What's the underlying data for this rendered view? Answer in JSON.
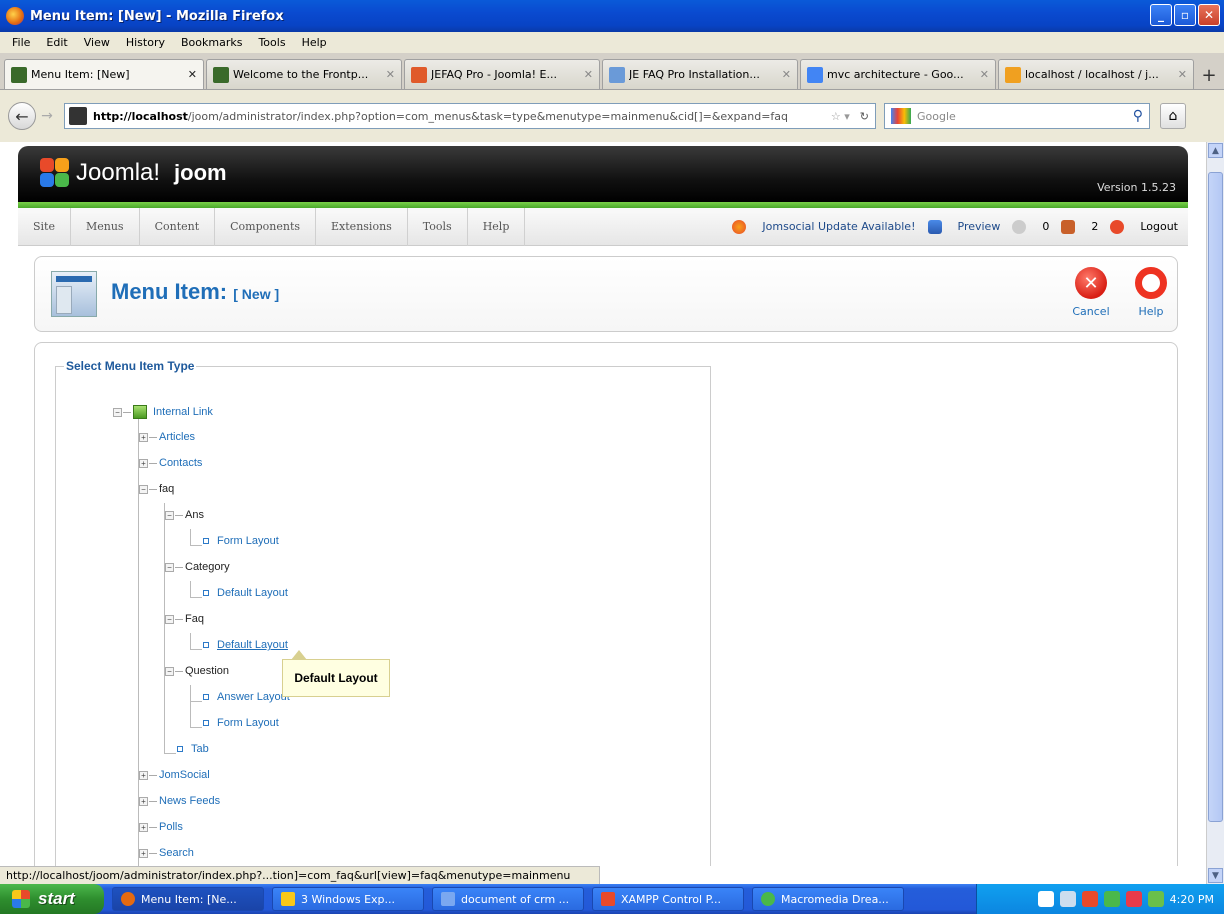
{
  "window": {
    "title": "Menu Item: [New] - Mozilla Firefox"
  },
  "menubar": {
    "items": [
      "File",
      "Edit",
      "View",
      "History",
      "Bookmarks",
      "Tools",
      "Help"
    ]
  },
  "tabs": [
    {
      "label": "Menu Item: [New]",
      "color": "#3a6a2a"
    },
    {
      "label": "Welcome to the Frontp...",
      "color": "#3a6a2a"
    },
    {
      "label": "JEFAQ Pro - Joomla! E...",
      "color": "#e05a2a"
    },
    {
      "label": "JE FAQ Pro Installation...",
      "color": "#6a9ad8"
    },
    {
      "label": "mvc architecture - Goo...",
      "color": "#4285f4"
    },
    {
      "label": "localhost / localhost / j...",
      "color": "#f0a020"
    }
  ],
  "navbar": {
    "url_host": "http://localhost",
    "url_path": "/joom/administrator/index.php?option=com_menus&task=type&menutype=mainmenu&cid[]=&expand=faq",
    "search_placeholder": "Google"
  },
  "joomla": {
    "wordmark": "Joomla!",
    "site_name": "joom",
    "version": "Version 1.5.23",
    "menu": [
      "Site",
      "Menus",
      "Content",
      "Components",
      "Extensions",
      "Tools",
      "Help"
    ],
    "status": {
      "update": "Jomsocial Update Available!",
      "preview": "Preview",
      "messages": "0",
      "users": "2",
      "logout": "Logout"
    },
    "page_title": "Menu Item:",
    "page_subtitle": "[ New ]",
    "toolbar": {
      "cancel": "Cancel",
      "help": "Help"
    },
    "fieldset_legend": "Select Menu Item Type",
    "tree": {
      "internal_link": "Internal Link",
      "articles": "Articles",
      "contacts": "Contacts",
      "faq": "faq",
      "ans": "Ans",
      "ans_form": "Form Layout",
      "category": "Category",
      "category_default": "Default Layout",
      "faq_node": "Faq",
      "faq_default": "Default Layout",
      "question": "Question",
      "question_answer": "Answer Layout",
      "question_form": "Form Layout",
      "tab": "Tab",
      "jomsocial": "JomSocial",
      "newsfeeds": "News Feeds",
      "polls": "Polls",
      "search": "Search"
    },
    "tooltip": "Default Layout"
  },
  "statusbar": {
    "text": "http://localhost/joom/administrator/index.php?...tion]=com_faq&url[view]=faq&menutype=mainmenu"
  },
  "taskbar": {
    "start": "start",
    "items": [
      {
        "label": "Menu Item: [Ne...",
        "color": "#e46a10"
      },
      {
        "label": "3 Windows Exp...",
        "color": "#f8c81a"
      },
      {
        "label": "document of crm ...",
        "color": "#2a6ae0"
      },
      {
        "label": "XAMPP Control P...",
        "color": "#e84a2a"
      },
      {
        "label": "Macromedia Drea...",
        "color": "#4ab84a"
      }
    ],
    "clock": "4:20 PM"
  }
}
